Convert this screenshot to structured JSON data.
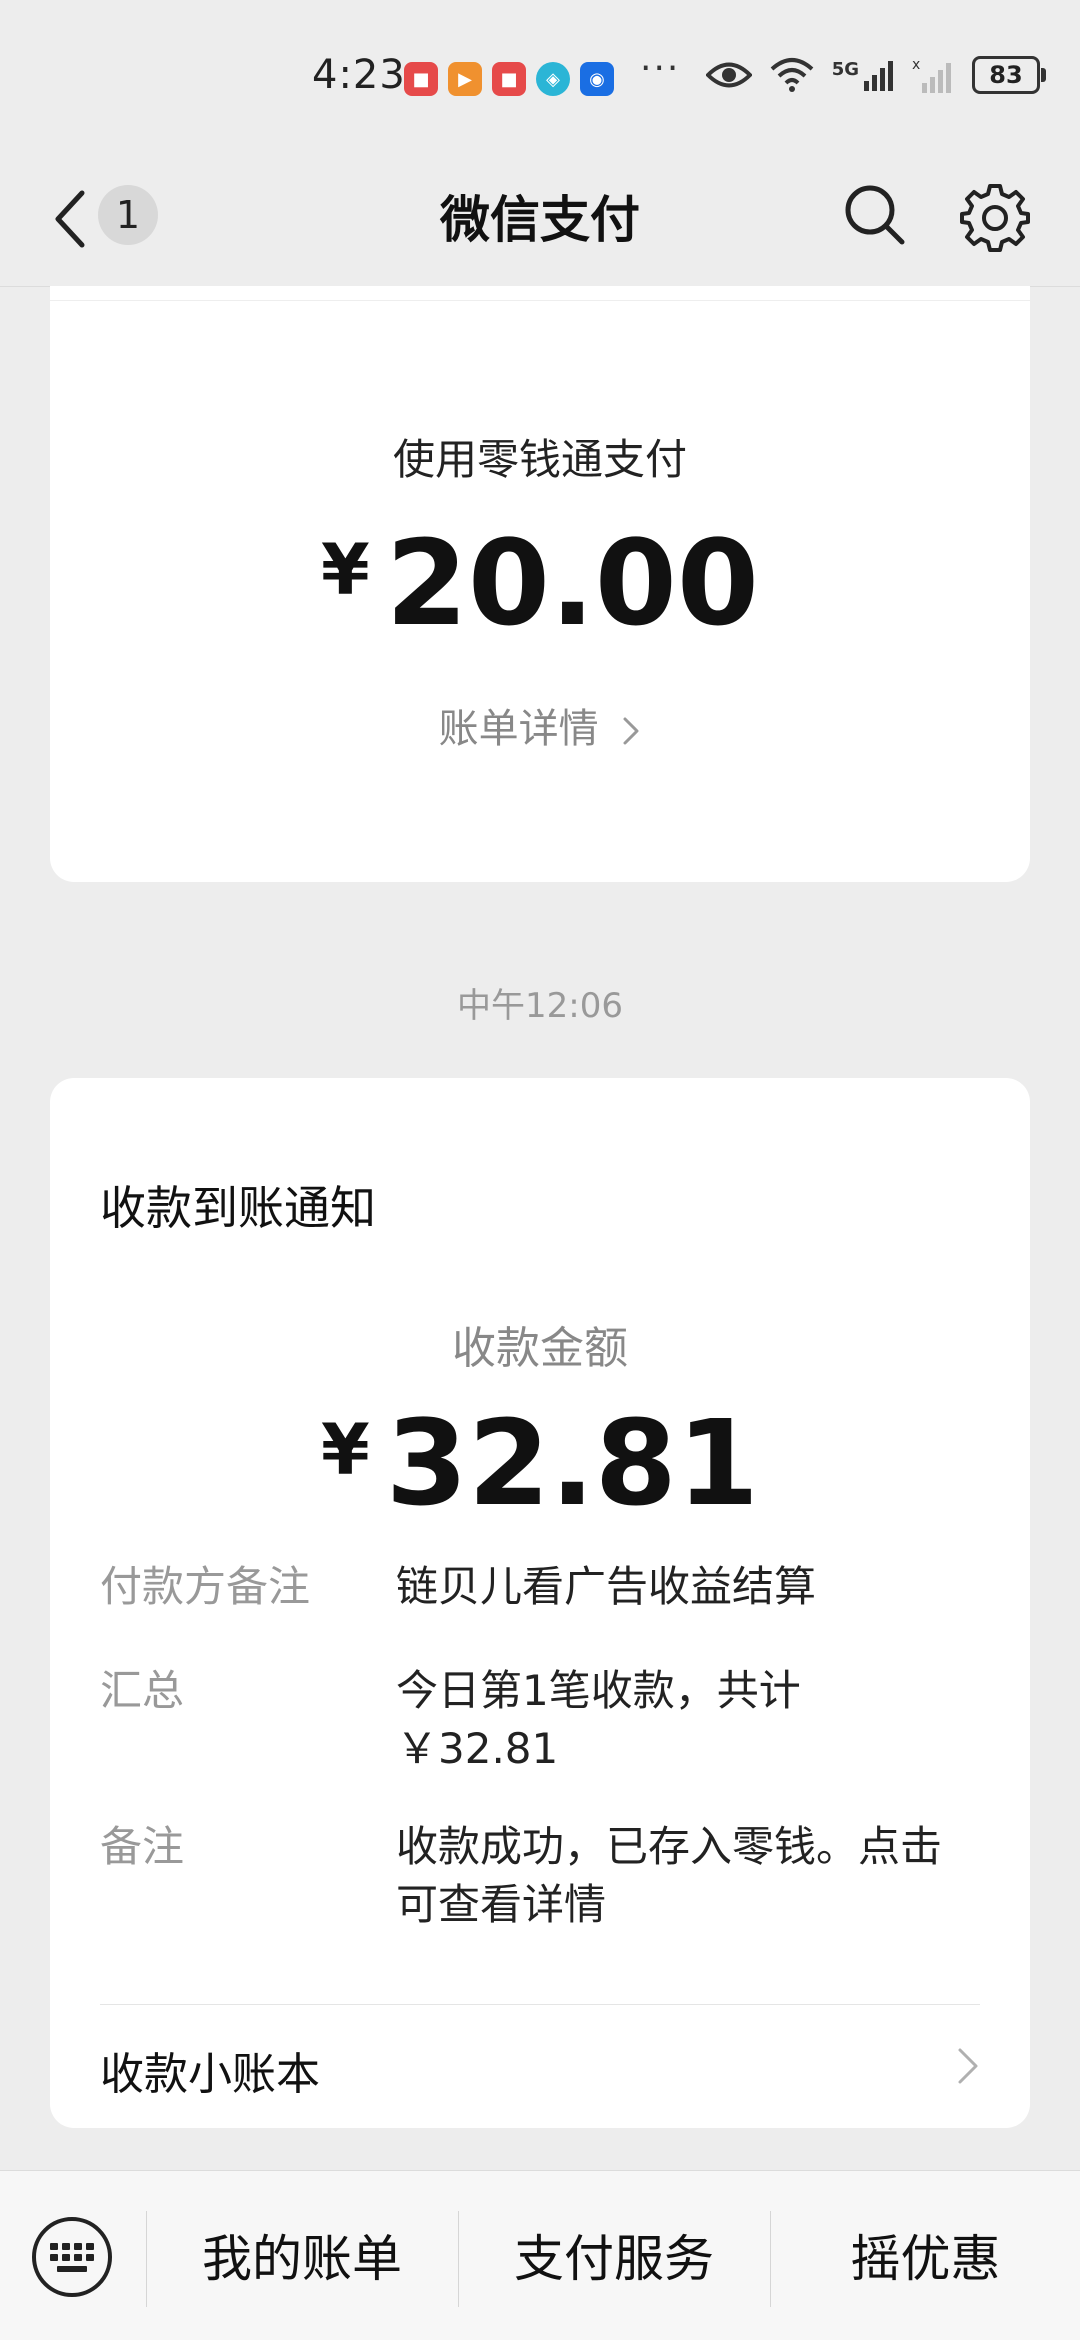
{
  "status_bar": {
    "time": "4:23",
    "more": "···",
    "network": "5G",
    "battery": "83"
  },
  "nav": {
    "title": "微信支付",
    "unread_count": "1"
  },
  "payment_card": {
    "method": "使用零钱通支付",
    "currency": "¥",
    "amount": "20.00",
    "bill_link": "账单详情"
  },
  "message_time": "中午12:06",
  "receipt_card": {
    "title": "收款到账通知",
    "amount_label": "收款金额",
    "currency": "¥",
    "amount": "32.81",
    "details": [
      {
        "key": "付款方备注",
        "value": "链贝儿看广告收益结算"
      },
      {
        "key": "汇总",
        "value": "今日第1笔收款，共计\n￥32.81"
      },
      {
        "key": "备注",
        "value": "收款成功，已存入零钱。点击可查看详情"
      }
    ],
    "ledger_link": "收款小账本"
  },
  "bottom_menu": {
    "items": [
      "我的账单",
      "支付服务",
      "摇优惠"
    ]
  },
  "colors": {
    "background": "#ededed",
    "card": "#ffffff",
    "muted_text": "#888888"
  }
}
